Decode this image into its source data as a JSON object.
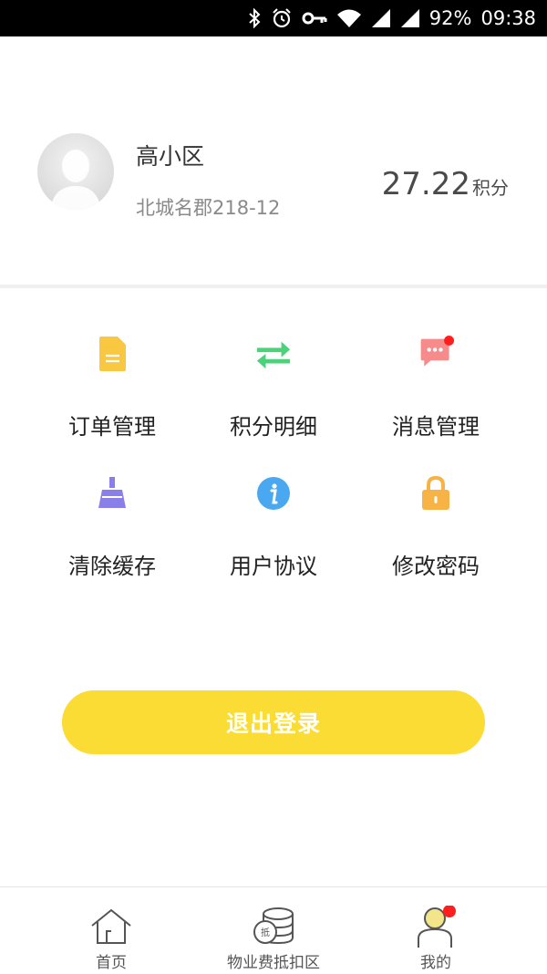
{
  "status_bar": {
    "battery_percent": "92%",
    "time": "09:38",
    "icons": [
      "bluetooth-icon",
      "alarm-icon",
      "vpn-key-icon",
      "wifi-icon",
      "signal-icon",
      "signal-icon"
    ]
  },
  "profile": {
    "name": "高小区",
    "address": "北城名郡218-12",
    "points_value": "27.22",
    "points_unit": "积分"
  },
  "menu": [
    {
      "label": "订单管理",
      "icon": "document-icon",
      "color": "#f9c740"
    },
    {
      "label": "积分明细",
      "icon": "swap-arrows-icon",
      "color": "#4cd27a"
    },
    {
      "label": "消息管理",
      "icon": "chat-bubble-icon",
      "color": "#f68b8b",
      "badge": true
    },
    {
      "label": "清除缓存",
      "icon": "broom-icon",
      "color": "#8a7ee8"
    },
    {
      "label": "用户协议",
      "icon": "info-icon",
      "color": "#4aa8f0"
    },
    {
      "label": "修改密码",
      "icon": "lock-icon",
      "color": "#f7b346"
    }
  ],
  "logout_label": "退出登录",
  "tabs": [
    {
      "label": "首页",
      "icon": "home-icon"
    },
    {
      "label": "物业费抵扣区",
      "icon": "coins-icon"
    },
    {
      "label": "我的",
      "icon": "user-icon",
      "badge": true
    }
  ],
  "colors": {
    "accent": "#fbdc34",
    "badge": "#ff1e1e"
  }
}
